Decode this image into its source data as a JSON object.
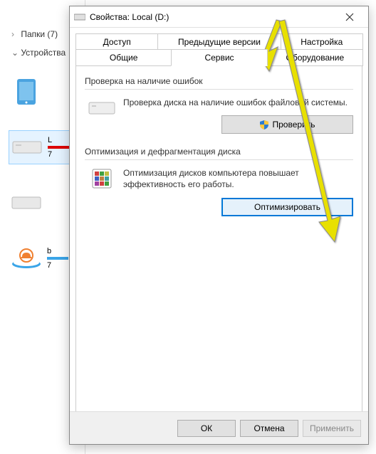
{
  "explorer": {
    "nav": {
      "folders": "Папки (7)",
      "devices": "Устройства"
    },
    "drives": [
      {
        "label": "",
        "sub": ""
      },
      {
        "label": "L",
        "sub": "7"
      },
      {
        "label": "",
        "sub": ""
      },
      {
        "label": "b",
        "sub": "7"
      }
    ]
  },
  "dialog": {
    "title": "Свойства: Local (D:)",
    "tabs": {
      "row1": [
        "Доступ",
        "Предыдущие версии",
        "Настройка"
      ],
      "row2": [
        "Общие",
        "Сервис",
        "Оборудование"
      ],
      "active": "Сервис"
    },
    "group_check": {
      "title": "Проверка на наличие ошибок",
      "desc": "Проверка диска на наличие ошибок файловой системы.",
      "button": "Проверить"
    },
    "group_optimize": {
      "title": "Оптимизация и дефрагментация диска",
      "desc": "Оптимизация дисков компьютера повышает эффективность его работы.",
      "button": "Оптимизировать"
    },
    "footer": {
      "ok": "ОК",
      "cancel": "Отмена",
      "apply": "Применить"
    }
  }
}
